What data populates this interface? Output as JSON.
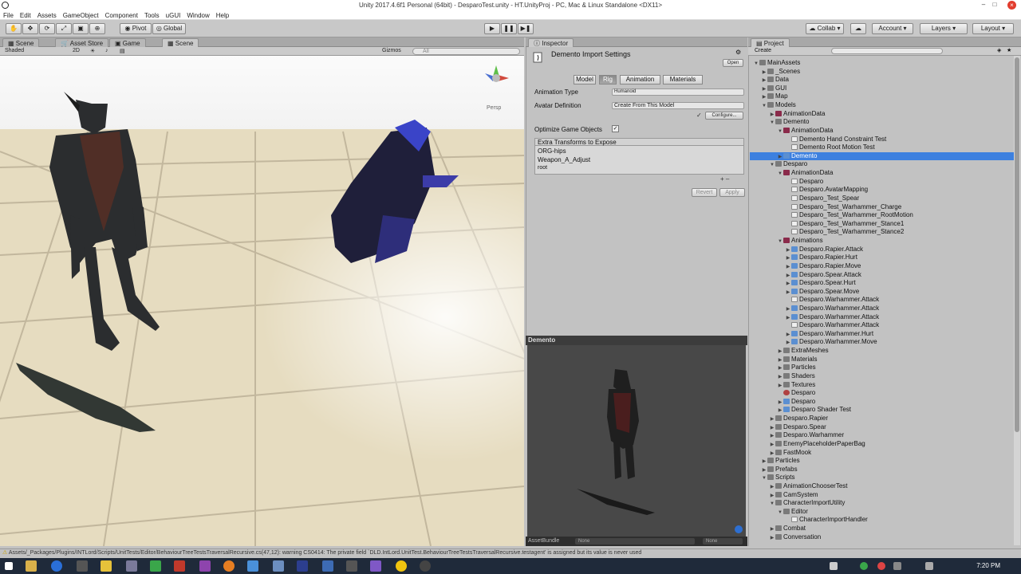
{
  "window": {
    "title": "Unity 2017.4.6f1 Personal (64bit) - DesparoTest.unity - HT.UnityProj - PC, Mac & Linux Standalone <DX11>"
  },
  "menu": [
    "File",
    "Edit",
    "Assets",
    "GameObject",
    "Component",
    "Tools",
    "uGUI",
    "Window",
    "Help"
  ],
  "toolbar": {
    "pivot": "Pivot",
    "global": "Global",
    "collab": "Collab",
    "account": "Account",
    "layers": "Layers",
    "layout": "Layout"
  },
  "tabs_left": [
    {
      "label": "Scene"
    },
    {
      "label": "Asset Store"
    },
    {
      "label": "Game"
    },
    {
      "label": "Scene"
    }
  ],
  "scene_toolbar": {
    "shading": "Shaded",
    "mode_2d": "2D",
    "gizmos": "Gizmos",
    "search": "All",
    "persp": "Persp"
  },
  "inspector": {
    "tab": "Inspector",
    "title": "Demento Import Settings",
    "open": "Open",
    "subtabs": [
      "Model",
      "Rig",
      "Animation",
      "Materials"
    ],
    "animation_type_label": "Animation Type",
    "animation_type_value": "Humanoid",
    "avatar_def_label": "Avatar Definition",
    "avatar_def_value": "Create From This Model",
    "configure": "Configure...",
    "optimize_label": "Optimize Game Objects",
    "extra_title": "Extra Transforms to Expose",
    "extra_items": [
      "ORG-hips",
      "Weapon_A_Adjust",
      "root"
    ],
    "revert": "Revert",
    "apply": "Apply"
  },
  "preview": {
    "title": "Demento",
    "assetbundle": "AssetBundle",
    "none1": "None",
    "none2": "None"
  },
  "project": {
    "tab": "Project",
    "create": "Create",
    "rows": [
      {
        "d": 0,
        "t": "MainAssets",
        "i": "folder",
        "a": "▼"
      },
      {
        "d": 1,
        "t": "_Scenes",
        "i": "folder",
        "a": "▶"
      },
      {
        "d": 1,
        "t": "Data",
        "i": "folder",
        "a": "▶"
      },
      {
        "d": 1,
        "t": "GUI",
        "i": "folder",
        "a": "▶"
      },
      {
        "d": 1,
        "t": "Map",
        "i": "folder",
        "a": "▶"
      },
      {
        "d": 1,
        "t": "Models",
        "i": "folder",
        "a": "▼"
      },
      {
        "d": 2,
        "t": "AnimationData",
        "i": "pack",
        "a": "▶"
      },
      {
        "d": 2,
        "t": "Demento",
        "i": "folder",
        "a": "▼"
      },
      {
        "d": 3,
        "t": "AnimationData",
        "i": "pack",
        "a": "▼"
      },
      {
        "d": 4,
        "t": "Demento Hand Constraint Test",
        "i": "file",
        "a": ""
      },
      {
        "d": 4,
        "t": "Demento Root Motion Test",
        "i": "file",
        "a": ""
      },
      {
        "d": 3,
        "t": "Demento",
        "i": "prefab",
        "a": "▶",
        "sel": true
      },
      {
        "d": 2,
        "t": "Desparo",
        "i": "folder",
        "a": "▼"
      },
      {
        "d": 3,
        "t": "AnimationData",
        "i": "pack",
        "a": "▼"
      },
      {
        "d": 4,
        "t": "Desparo",
        "i": "file",
        "a": ""
      },
      {
        "d": 4,
        "t": "Desparo.AvatarMapping",
        "i": "file",
        "a": ""
      },
      {
        "d": 4,
        "t": "Desparo_Test_Spear",
        "i": "file",
        "a": ""
      },
      {
        "d": 4,
        "t": "Desparo_Test_Warhammer_Charge",
        "i": "file",
        "a": ""
      },
      {
        "d": 4,
        "t": "Desparo_Test_Warhammer_RootMotion",
        "i": "file",
        "a": ""
      },
      {
        "d": 4,
        "t": "Desparo_Test_Warhammer_Stance1",
        "i": "file",
        "a": ""
      },
      {
        "d": 4,
        "t": "Desparo_Test_Warhammer_Stance2",
        "i": "file",
        "a": ""
      },
      {
        "d": 3,
        "t": "Animations",
        "i": "pack",
        "a": "▼"
      },
      {
        "d": 4,
        "t": "Desparo.Rapier.Attack",
        "i": "prefab",
        "a": "▶"
      },
      {
        "d": 4,
        "t": "Desparo.Rapier.Hurt",
        "i": "prefab",
        "a": "▶"
      },
      {
        "d": 4,
        "t": "Desparo.Rapier.Move",
        "i": "prefab",
        "a": "▶"
      },
      {
        "d": 4,
        "t": "Desparo.Spear.Attack",
        "i": "prefab",
        "a": "▶"
      },
      {
        "d": 4,
        "t": "Desparo.Spear.Hurt",
        "i": "prefab",
        "a": "▶"
      },
      {
        "d": 4,
        "t": "Desparo.Spear.Move",
        "i": "prefab",
        "a": "▶"
      },
      {
        "d": 4,
        "t": "Desparo.Warhammer.Attack",
        "i": "file",
        "a": ""
      },
      {
        "d": 4,
        "t": "Desparo.Warhammer.Attack",
        "i": "prefab",
        "a": "▶"
      },
      {
        "d": 4,
        "t": "Desparo.Warhammer.Attack",
        "i": "prefab",
        "a": "▶"
      },
      {
        "d": 4,
        "t": "Desparo.Warhammer.Attack",
        "i": "file",
        "a": ""
      },
      {
        "d": 4,
        "t": "Desparo.Warhammer.Hurt",
        "i": "prefab",
        "a": "▶"
      },
      {
        "d": 4,
        "t": "Desparo.Warhammer.Move",
        "i": "prefab",
        "a": "▶"
      },
      {
        "d": 3,
        "t": "ExtraMeshes",
        "i": "folder",
        "a": "▶"
      },
      {
        "d": 3,
        "t": "Materials",
        "i": "folder",
        "a": "▶"
      },
      {
        "d": 3,
        "t": "Particles",
        "i": "folder",
        "a": "▶"
      },
      {
        "d": 3,
        "t": "Shaders",
        "i": "folder",
        "a": "▶"
      },
      {
        "d": 3,
        "t": "Textures",
        "i": "folder",
        "a": "▶"
      },
      {
        "d": 3,
        "t": "Desparo",
        "i": "mat",
        "a": ""
      },
      {
        "d": 3,
        "t": "Desparo",
        "i": "prefab",
        "a": "▶"
      },
      {
        "d": 3,
        "t": "Desparo Shader Test",
        "i": "prefab",
        "a": "▶"
      },
      {
        "d": 2,
        "t": "Desparo.Rapier",
        "i": "folder",
        "a": "▶"
      },
      {
        "d": 2,
        "t": "Desparo.Spear",
        "i": "folder",
        "a": "▶"
      },
      {
        "d": 2,
        "t": "Desparo.Warhammer",
        "i": "folder",
        "a": "▶"
      },
      {
        "d": 2,
        "t": "EnemyPlaceholderPaperBag",
        "i": "folder",
        "a": "▶"
      },
      {
        "d": 2,
        "t": "FastMook",
        "i": "folder",
        "a": "▶"
      },
      {
        "d": 1,
        "t": "Particles",
        "i": "folder",
        "a": "▶"
      },
      {
        "d": 1,
        "t": "Prefabs",
        "i": "folder",
        "a": "▶"
      },
      {
        "d": 1,
        "t": "Scripts",
        "i": "folder",
        "a": "▼"
      },
      {
        "d": 2,
        "t": "AnimationChooserTest",
        "i": "folder",
        "a": "▶"
      },
      {
        "d": 2,
        "t": "CamSystem",
        "i": "folder",
        "a": "▶"
      },
      {
        "d": 2,
        "t": "CharacterImportUtility",
        "i": "folder",
        "a": "▼"
      },
      {
        "d": 3,
        "t": "Editor",
        "i": "folder",
        "a": "▼"
      },
      {
        "d": 4,
        "t": "CharacterImportHandler",
        "i": "file",
        "a": ""
      },
      {
        "d": 2,
        "t": "Combat",
        "i": "folder",
        "a": "▶"
      },
      {
        "d": 2,
        "t": "Conversation",
        "i": "folder",
        "a": "▶"
      }
    ]
  },
  "status": "Assets/_Packages/Plugins/INTLord/Scripts/UnitTests/Editor/BehaviourTreeTestsTraversalRecursive.cs(47,12): warning CS0414: The private field `DLD.IntLord.UnitTest.BehaviourTreeTestsTraversalRecursive.testagent' is assigned but its value is never used",
  "clock": "7:20 PM"
}
